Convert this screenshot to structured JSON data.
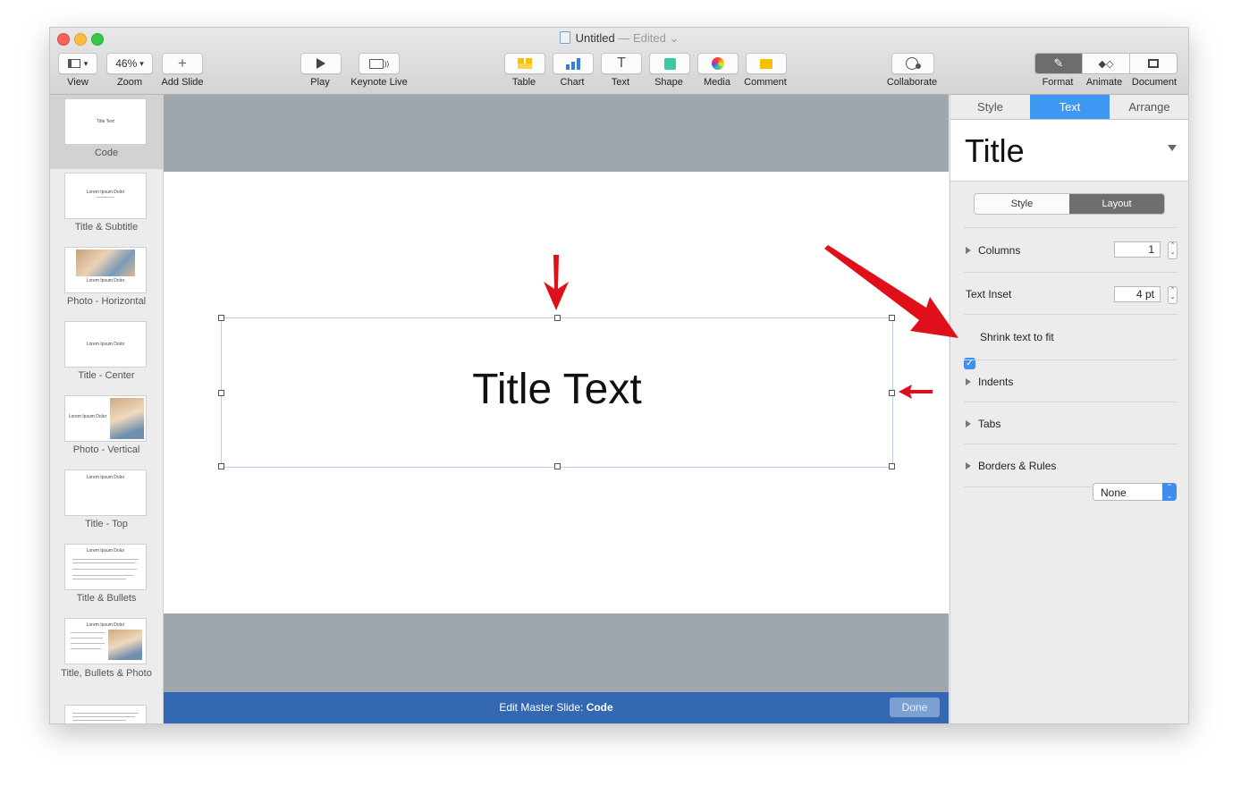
{
  "window": {
    "title": "Untitled",
    "title_separator": " — ",
    "status": "Edited"
  },
  "toolbar": {
    "view": {
      "label": "View",
      "icon": "view-layout-icon"
    },
    "zoom": {
      "label": "Zoom",
      "value": "46%"
    },
    "add_slide": {
      "label": "Add Slide",
      "icon": "plus-icon"
    },
    "play": {
      "label": "Play",
      "icon": "play-icon"
    },
    "keynote_live": {
      "label": "Keynote Live",
      "icon": "keynote-live-icon"
    },
    "table": {
      "label": "Table",
      "icon": "table-icon"
    },
    "chart": {
      "label": "Chart",
      "icon": "chart-icon"
    },
    "text": {
      "label": "Text",
      "icon": "text-icon"
    },
    "shape": {
      "label": "Shape",
      "icon": "shape-icon"
    },
    "media": {
      "label": "Media",
      "icon": "media-icon"
    },
    "comment": {
      "label": "Comment",
      "icon": "comment-icon"
    },
    "collaborate": {
      "label": "Collaborate",
      "icon": "collaborate-icon"
    },
    "format": {
      "label": "Format",
      "icon": "format-brush-icon",
      "active": true
    },
    "animate": {
      "label": "Animate",
      "icon": "animate-icon"
    },
    "document": {
      "label": "Document",
      "icon": "document-icon"
    }
  },
  "sidebar": {
    "items": [
      {
        "label": "Code",
        "thumb_text": "Title Text",
        "selected": true
      },
      {
        "label": "Title & Subtitle",
        "thumb_text": "Lorem Ipsum Dolor"
      },
      {
        "label": "Photo - Horizontal",
        "thumb_text": "Lorem Ipsum Dolor"
      },
      {
        "label": "Title - Center",
        "thumb_text": "Lorem Ipsum Dolor"
      },
      {
        "label": "Photo - Vertical",
        "thumb_text": "Lorem Ipsum Dolor"
      },
      {
        "label": "Title - Top",
        "thumb_text": "Lorem Ipsum Dolor"
      },
      {
        "label": "Title & Bullets",
        "thumb_text": "Lorem Ipsum Dolor"
      },
      {
        "label": "Title, Bullets & Photo",
        "thumb_text": "Lorem Ipsum Dolor"
      }
    ]
  },
  "slide": {
    "title_text": "Title Text"
  },
  "bottom_bar": {
    "prefix": "Edit Master Slide: ",
    "master_name": "Code",
    "done_label": "Done"
  },
  "inspector": {
    "tabs": [
      "Style",
      "Text",
      "Arrange"
    ],
    "active_tab": "Text",
    "paragraph_style": "Title",
    "sub_tabs": [
      "Style",
      "Layout"
    ],
    "active_sub_tab": "Layout",
    "columns": {
      "label": "Columns",
      "value": "1"
    },
    "text_inset": {
      "label": "Text Inset",
      "value": "4 pt"
    },
    "shrink_text": {
      "label": "Shrink text to fit",
      "checked": true
    },
    "indents": {
      "label": "Indents"
    },
    "tabs_section": {
      "label": "Tabs"
    },
    "borders": {
      "label": "Borders & Rules",
      "value": "None"
    }
  },
  "colors": {
    "accent": "#3e98f3",
    "bottom_bar": "#3468b3",
    "annotation_arrow": "#e0101a"
  }
}
